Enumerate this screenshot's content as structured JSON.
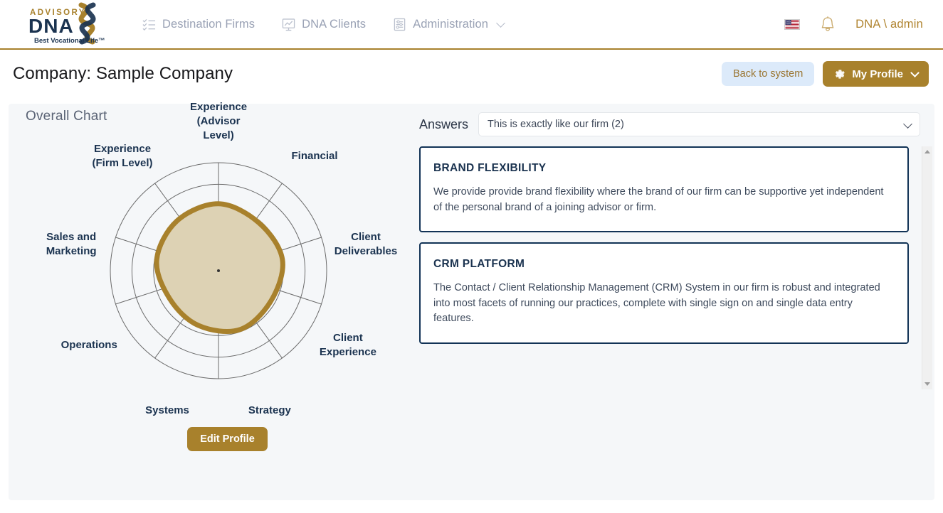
{
  "nav": {
    "brand": {
      "line1": "ADVISORY",
      "line2": "DNA",
      "tagline": "Best Vocational Life™"
    },
    "links": [
      {
        "label": "Destination Firms",
        "icon": "checklist-icon"
      },
      {
        "label": "DNA Clients",
        "icon": "chart-board-icon"
      },
      {
        "label": "Administration",
        "icon": "settings-list-icon",
        "has_caret": true
      }
    ],
    "right": {
      "language_icon": "us-flag-icon",
      "notifications_icon": "bell-icon",
      "user": "DNA \\ admin"
    }
  },
  "header": {
    "title": "Company: Sample Company",
    "back_button": "Back to system",
    "profile_button": "My Profile"
  },
  "chart_panel": {
    "caption": "Overall Chart",
    "edit_button": "Edit Profile"
  },
  "answers_panel": {
    "label": "Answers",
    "selected_option": "This is exactly like our firm (2)",
    "cards": [
      {
        "title": "BRAND FLEXIBILITY",
        "body": "We provide provide brand flexibility where the brand of our firm can be supportive yet independent of the personal brand of a joining advisor or firm."
      },
      {
        "title": "CRM PLATFORM",
        "body": "The Contact / Client Relationship Management (CRM) System in our firm is robust and integrated into most facets of running our practices, complete with single sign on and single data entry features."
      }
    ]
  },
  "chart_data": {
    "type": "radar",
    "title": "Overall Chart",
    "categories": [
      "Experience\n(Advisor\nLevel)",
      "Financial",
      "Client\nDeliverables",
      "Client\nExperience",
      "Strategy",
      "Systems",
      "Operations",
      "Sales and\nMarketing",
      "Experience\n(Firm Level)"
    ],
    "rings": 5,
    "spokes": 10,
    "rmax": 5,
    "series": [
      {
        "name": "Sample Company",
        "values": [
          3.1,
          2.9,
          3.0,
          2.8,
          2.9,
          2.7,
          2.6,
          2.9,
          3.0
        ],
        "fill_color": "#ddd2b4",
        "line_color": "#a8812c"
      }
    ],
    "grid_color": "#6b6b6b",
    "label_color": "#1b3350"
  }
}
